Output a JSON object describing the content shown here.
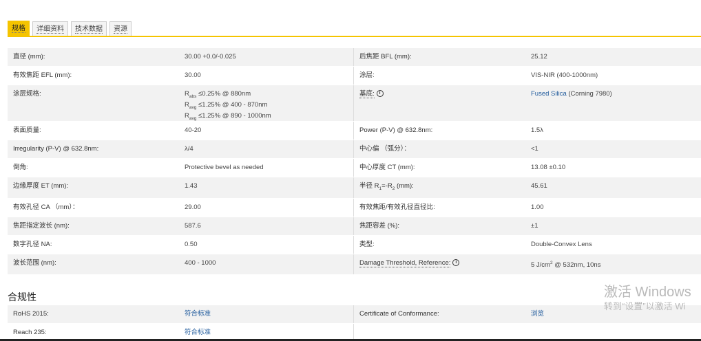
{
  "tabs": [
    {
      "label": "规格",
      "active": true
    },
    {
      "label": "详细资料",
      "active": false
    },
    {
      "label": "技术数据",
      "active": false
    },
    {
      "label": "资源",
      "active": false
    }
  ],
  "specs": {
    "diameter": {
      "label": "直径 (mm):",
      "value": "30.00 +0.0/-0.025"
    },
    "bfl": {
      "label": "后焦距 BFL (mm):",
      "value": "25.12"
    },
    "efl": {
      "label": "有效焦距 EFL (mm):",
      "value": "30.00"
    },
    "coating": {
      "label": "涂层:",
      "value": "VIS-NIR (400-1000nm)"
    },
    "coating_spec": {
      "label": "涂层规格:",
      "line1": {
        "r": "R",
        "sub": "abs",
        "text": " ≤0.25% @ 880nm"
      },
      "line2": {
        "r": "R",
        "sub": "avg",
        "text": " ≤1.25% @ 400 - 870nm"
      },
      "line3": {
        "r": "R",
        "sub": "avg",
        "text": " ≤1.25% @ 890 - 1000nm"
      }
    },
    "substrate": {
      "label": "基底:",
      "info": "i",
      "value_link": "Fused Silica",
      "value_rest": " (Corning 7980)"
    },
    "surface_quality": {
      "label": "表面质量:",
      "value": "40-20"
    },
    "power": {
      "label": "Power (P-V) @ 632.8nm:",
      "value": "1.5λ"
    },
    "irregularity": {
      "label": "Irregularity (P-V) @ 632.8nm:",
      "value": "λ/4"
    },
    "centering": {
      "label": "中心偏 （弧分）：",
      "value": "<1"
    },
    "bevel": {
      "label": "倒角:",
      "value": "Protective bevel as needed"
    },
    "ct": {
      "label": "中心厚度 CT (mm):",
      "value": "13.08 ±0.10"
    },
    "et": {
      "label": "边缘厚度 ET (mm):",
      "value": "1.43"
    },
    "radius": {
      "label_prefix": "半径 R",
      "sub1": "1",
      "mid": "=-R",
      "sub2": "2",
      "label_suffix": " (mm):",
      "value": "45.61"
    },
    "ca": {
      "label": "有效孔径 CA （mm）：",
      "value": "29.00"
    },
    "f_number": {
      "label": "有效焦距/有效孔径直径比:",
      "value": "1.00"
    },
    "design_wavelength": {
      "label": "焦距指定波长 (nm):",
      "value": "587.6"
    },
    "focal_tolerance": {
      "label": "焦距容差 (%):",
      "value": "±1"
    },
    "na": {
      "label": "数字孔径 NA:",
      "value": "0.50"
    },
    "type": {
      "label": "类型:",
      "value": "Double-Convex Lens"
    },
    "wavelength_range": {
      "label": "波长范围 (nm):",
      "value": "400 - 1000"
    },
    "damage": {
      "label": "Damage Threshold, Reference:",
      "info": "i",
      "value_pre": "5 J/cm",
      "sup": "2",
      "value_post": " @ 532nm, 10ns"
    }
  },
  "compliance": {
    "title": "合规性",
    "rohs": {
      "label": "RoHS 2015:",
      "value": "符合标准"
    },
    "coc": {
      "label": "Certificate of Conformance:",
      "value": "浏览"
    },
    "reach": {
      "label": "Reach 235:",
      "value": "符合标准"
    }
  },
  "watermark": {
    "line1": "激活 Windows",
    "line2": "转到“设置”以激活 Wi"
  },
  "colors": {
    "accent": "#f5c400",
    "link": "#1f5a9c",
    "stripe": "#f2f2f2"
  }
}
